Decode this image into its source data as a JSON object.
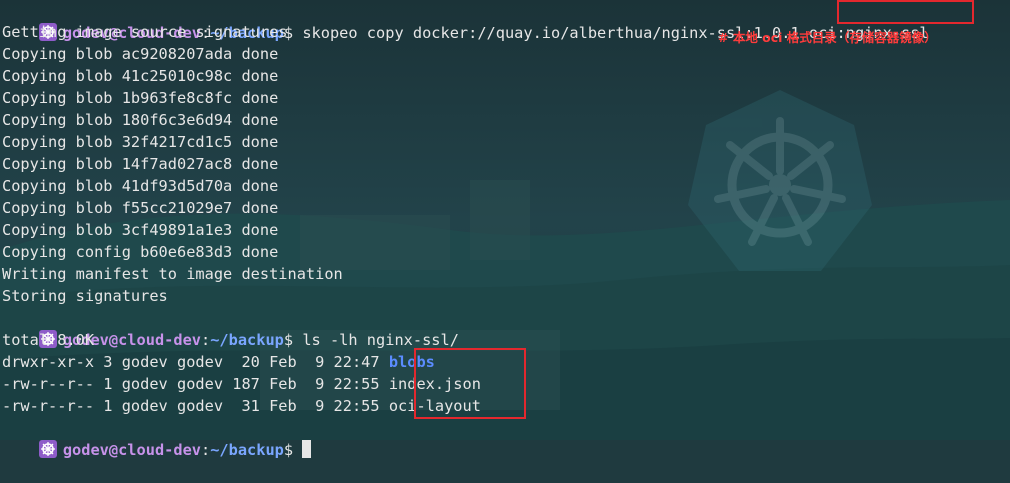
{
  "terminal": {
    "prompt": {
      "user_host": "godev@cloud-dev",
      "colon": ":",
      "path": "~/backup",
      "symbol": "$"
    },
    "cmd1": "skopeo copy docker://quay.io/alberthua/nginx-ssl:1.0.1",
    "cmd1_target": "oci:nginx-ssl",
    "annotation": "# 本地 oci 格式目录（存储容器镜像）",
    "output1": [
      "Getting image source signatures",
      "Copying blob ac9208207ada done",
      "Copying blob 41c25010c98c done",
      "Copying blob 1b963fe8c8fc done",
      "Copying blob 180f6c3e6d94 done",
      "Copying blob 32f4217cd1c5 done",
      "Copying blob 14f7ad027ac8 done",
      "Copying blob 41df93d5d70a done",
      "Copying blob f55cc21029e7 done",
      "Copying blob 3cf49891a1e3 done",
      "Copying config b60e6e83d3 done",
      "Writing manifest to image destination",
      "Storing signatures"
    ],
    "cmd2": "ls -lh nginx-ssl/",
    "total": "total 8.0K",
    "listing": [
      {
        "meta": "drwxr-xr-x 3 godev godev  20 Feb  9 22:47",
        "name": "blobs",
        "is_dir": true
      },
      {
        "meta": "-rw-r--r-- 1 godev godev 187 Feb  9 22:55",
        "name": "index.json",
        "is_dir": false
      },
      {
        "meta": "-rw-r--r-- 1 godev godev  31 Feb  9 22:55",
        "name": "oci-layout",
        "is_dir": false
      }
    ]
  },
  "colors": {
    "background": "#1f3a3f",
    "prompt_user": "#c792ea",
    "prompt_path": "#7aa6ff",
    "directory": "#5b8cff",
    "highlight_box": "#e3282e",
    "annotation": "#ff3c3c"
  },
  "icons": {
    "prompt": "kubernetes-helm-icon",
    "background_logo": "kubernetes-helm-icon"
  }
}
